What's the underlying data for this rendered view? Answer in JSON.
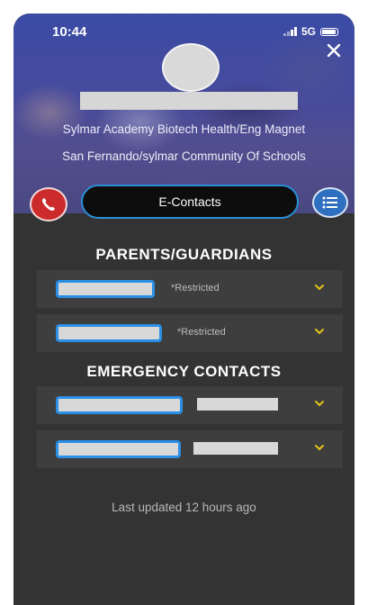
{
  "status_bar": {
    "time": "10:44",
    "network": "5G"
  },
  "header": {
    "school_line1": "Sylmar Academy Biotech Health/Eng Magnet",
    "school_line2": "San Fernando/sylmar Community Of Schools"
  },
  "actions": {
    "center_label": "E-Contacts",
    "call_icon": "phone-icon",
    "list_icon": "list-icon"
  },
  "parents": {
    "title": "PARENTS/GUARDIANS",
    "items": [
      {
        "status": "*Restricted"
      },
      {
        "status": "*Restricted"
      }
    ]
  },
  "emergency": {
    "title": "EMERGENCY CONTACTS"
  },
  "footer": {
    "last_updated": "Last updated 12 hours ago"
  },
  "colors": {
    "accent_blue": "#2a8fe6",
    "chevron_yellow": "#e6c21a",
    "call_red": "#cc2b2b",
    "background": "#333333",
    "row_bg": "#3e3e3e"
  }
}
